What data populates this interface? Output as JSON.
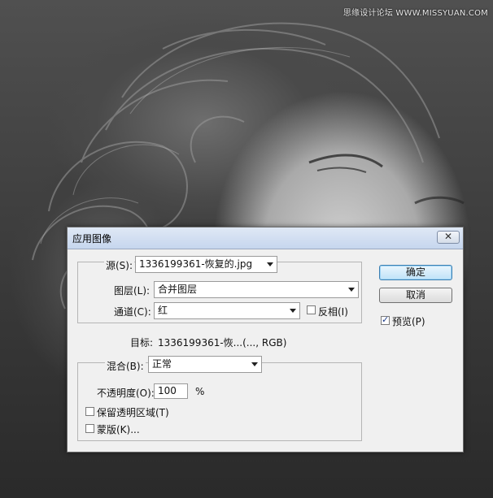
{
  "watermark": "思缘设计论坛 WWW.MISSYUAN.COM",
  "dialog": {
    "title": "应用图像",
    "close_glyph": "✕",
    "source": {
      "label": "源(S):",
      "value": "1336199361-恢复的.jpg"
    },
    "layer": {
      "label": "图层(L):",
      "value": "合并图层"
    },
    "channel": {
      "label": "通道(C):",
      "value": "红"
    },
    "invert": {
      "label": "反相(I)",
      "checked": false
    },
    "target": {
      "label": "目标:",
      "value": "1336199361-恢...(..., RGB)"
    },
    "blending": {
      "label": "混合(B):",
      "value": "正常"
    },
    "opacity": {
      "label": "不透明度(O):",
      "value": "100",
      "unit": "%"
    },
    "preserve_transparency": {
      "label": "保留透明区域(T)",
      "checked": false
    },
    "mask": {
      "label": "蒙版(K)...",
      "checked": false
    },
    "ok_label": "确定",
    "cancel_label": "取消",
    "preview": {
      "label": "预览(P)",
      "checked": true
    }
  }
}
